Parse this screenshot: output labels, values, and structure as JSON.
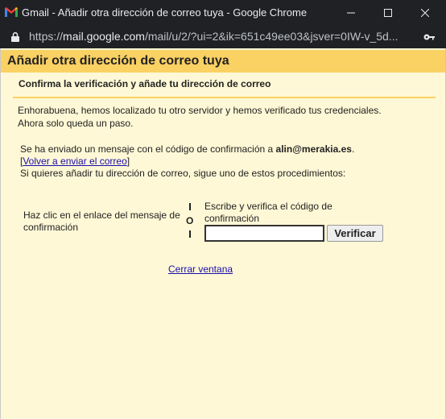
{
  "window": {
    "title": "Gmail - Añadir otra dirección de correo tuya - Google Chrome"
  },
  "address_bar": {
    "scheme": "https://",
    "host": "mail.google.com",
    "path": "/mail/u/2/?ui=2&ik=651c49ee03&jsver=0IW-v_5d..."
  },
  "dialog": {
    "title": "Añadir otra dirección de correo tuya",
    "subtitle": "Confirma la verificación y añade tu dirección de correo",
    "intro_line1": "Enhorabuena, hemos localizado tu otro servidor y hemos verificado tus credenciales.",
    "intro_line2": "Ahora solo queda un paso.",
    "sent_text": "Se ha enviado un mensaje con el código de confirmación a ",
    "email": "alin@merakia.es",
    "sent_end": ".",
    "resend_open": "[",
    "resend_link": "Volver a enviar el correo",
    "resend_close": "]",
    "procedure_text": "Si quieres añadir tu dirección de correo, sigue uno de estos procedimientos:",
    "option_left": "Haz clic en el enlace del mensaje de confirmación",
    "separator": "O",
    "option_right": "Escribe y verifica el código de confirmación",
    "code_value": "",
    "verify_button": "Verificar",
    "close_link": "Cerrar ventana"
  },
  "colors": {
    "header_bg": "#fad163",
    "page_bg": "#fff8d6",
    "link": "#1a0dab"
  }
}
